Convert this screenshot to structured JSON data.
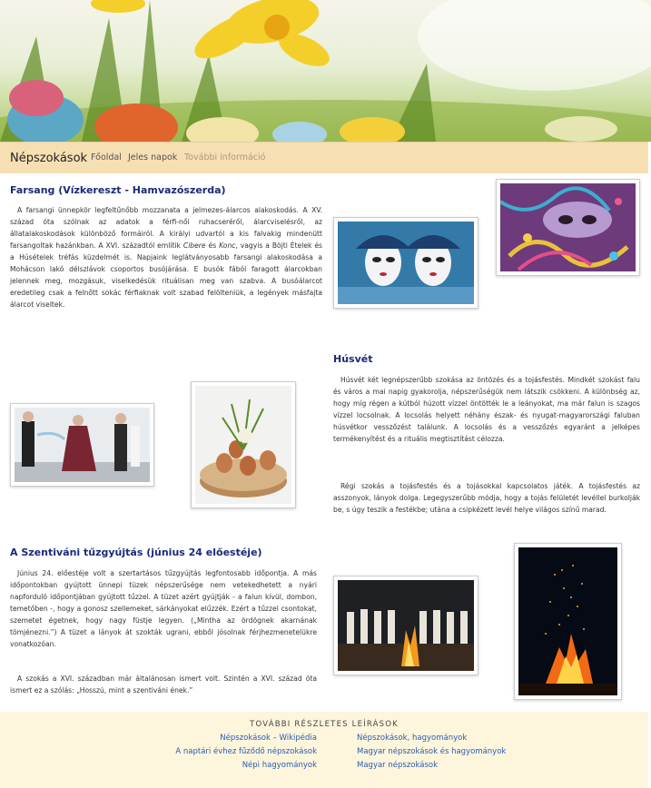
{
  "nav": {
    "brand": "Népszokások",
    "links": [
      "Főoldal",
      "Jeles napok",
      "További információ"
    ]
  },
  "sections": {
    "farsang": {
      "title": "Farsang (Vízkereszt - Hamvazószerda)",
      "p1_a": "A farsangi ünnepkör legfeltűnőbb mozzanata a jelmezes-álarcos alakoskodás. A XV. század óta szólnak az adatok a férfi-női ruhacseréről, álarcviselésről, az állatalakoskodások különböző formáiról. A királyi udvartól a kis falvakig mindenütt farsangoltak hazánkban. A XVI. századtól említik ",
      "p1_i1": "Cibere",
      "p1_b": " és ",
      "p1_i2": "Konc",
      "p1_c": ", vagyis a Böjti Ételek és a Húsételek tréfás küzdelmét is. Napjaink leglátványosabb farsangi alakoskodása a Mohácson lakó délszlávok csoportos busójárása. E busók fából faragott álarcokban jelennek meg, mozgásuk, viselkedésük rituálisan meg van szabva. A busóálarcot eredetileg csak a felnőtt sokác férfiaknak volt szabad felölteniük, a legények másfajta álarcot viseltek."
    },
    "husvet": {
      "title": "Húsvét",
      "p1": "Húsvét két legnépszerűbb szokása az öntözés és a tojásfestés. Mindkét szokást falu és város a mai napig gyakorolja, népszerűségük nem látszik csökkeni. A különbség az, hogy míg régen a kútból húzott vízzel öntötték le a leányokat, ma már falun is szagos vízzel locsolnak. A locsolás helyett néhány észak- és nyugat-magyarországi faluban húsvétkor vesszőzést találunk. A locsolás és a vesszőzés egyaránt a jelképes termékenyítést és a rituális megtisztítást célozza.",
      "p2": "Régi szokás a tojásfestés és a tojásokkal kapcsolatos játék. A tojásfestés az asszonyok, lányok dolga. Legegyszerűbb módja, hogy a tojás felületét levéllel burkolják be, s úgy teszik a festékbe; utána a csipkézett levél helye világos színű marad."
    },
    "szentivan": {
      "title": "A Szentiváni tűzgyújtás (június 24 előestéje)",
      "p1": "Június 24. előestéje volt a szertartásos tűzgyújtás legfontosabb időpontja. A más időpontokban gyújtott ünnepi tüzek népszerűsége nem vetekedhetett a nyári napforduló időpontjában gyújtott tűzzel. A tüzet azért gyújtják - a falun kívül, dombon, temetőben -, hogy a gonosz szellemeket, sárkányokat elűzzék. Ezért a tűzzel csontokat, szemetet égetnek, hogy nagy füstje legyen. („Mintha az ördögnek akarnának tömjénezni.”) A tüzet a lányok át szokták ugrani, ebből jósolnak férjhezmenetelükre vonatkozóan.",
      "p2": "A szokás a XVI. században már általánosan ismert volt. Szintén a XVI. század óta ismert ez a szólás: „Hosszú, mint a szentiváni ének.”"
    }
  },
  "footer": {
    "title": "TOVÁBBI RÉSZLETES LEÍRÁSOK",
    "left_links": [
      "Népszokások – Wikipédia",
      "A naptári évhez fűződő népszokások",
      "Népi hagyományok"
    ],
    "right_links": [
      "Népszokások, hagyományok",
      "Magyar népszokások és hagyományok",
      "Magyar népszokások"
    ]
  },
  "colors": {
    "nav_bg": "#f7dfb4",
    "heading": "#1a2a7a",
    "link": "#2a5db0",
    "footer_bg": "#fdf5dc"
  }
}
